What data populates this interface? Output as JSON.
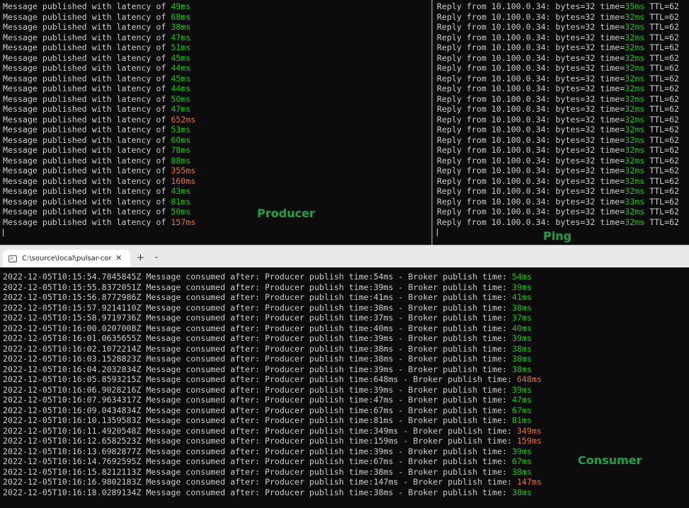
{
  "producer": {
    "prefix": "Message published with latency of ",
    "lines": [
      {
        "latency": "49ms",
        "status": "ok"
      },
      {
        "latency": "68ms",
        "status": "ok"
      },
      {
        "latency": "38ms",
        "status": "ok"
      },
      {
        "latency": "47ms",
        "status": "ok"
      },
      {
        "latency": "51ms",
        "status": "ok"
      },
      {
        "latency": "45ms",
        "status": "ok"
      },
      {
        "latency": "44ms",
        "status": "ok"
      },
      {
        "latency": "45ms",
        "status": "ok"
      },
      {
        "latency": "44ms",
        "status": "ok"
      },
      {
        "latency": "50ms",
        "status": "ok"
      },
      {
        "latency": "47ms",
        "status": "ok"
      },
      {
        "latency": "652ms",
        "status": "warn"
      },
      {
        "latency": "53ms",
        "status": "ok"
      },
      {
        "latency": "60ms",
        "status": "ok"
      },
      {
        "latency": "78ms",
        "status": "ok"
      },
      {
        "latency": "88ms",
        "status": "ok"
      },
      {
        "latency": "355ms",
        "status": "warn"
      },
      {
        "latency": "160ms",
        "status": "warn"
      },
      {
        "latency": "43ms",
        "status": "ok"
      },
      {
        "latency": "81ms",
        "status": "ok"
      },
      {
        "latency": "50ms",
        "status": "ok"
      },
      {
        "latency": "157ms",
        "status": "warn"
      }
    ],
    "label": "Producer"
  },
  "ping": {
    "prefix": "Reply from 10.100.0.34: bytes=32 time=",
    "suffix": " TTL=62",
    "lines": [
      {
        "time": "35ms"
      },
      {
        "time": "32ms"
      },
      {
        "time": "32ms"
      },
      {
        "time": "32ms"
      },
      {
        "time": "32ms"
      },
      {
        "time": "32ms"
      },
      {
        "time": "32ms"
      },
      {
        "time": "32ms"
      },
      {
        "time": "32ms"
      },
      {
        "time": "32ms"
      },
      {
        "time": "32ms"
      },
      {
        "time": "32ms"
      },
      {
        "time": "32ms"
      },
      {
        "time": "32ms"
      },
      {
        "time": "32ms"
      },
      {
        "time": "32ms"
      },
      {
        "time": "32ms"
      },
      {
        "time": "32ms"
      },
      {
        "time": "32ms"
      },
      {
        "time": "33ms"
      },
      {
        "time": "32ms"
      },
      {
        "time": "32ms"
      }
    ],
    "label": "Ping"
  },
  "tabs": {
    "active_title": "C:\\source\\local\\pulsar-consur",
    "close_glyph": "✕",
    "new_tab_glyph": "+",
    "dropdown_glyph": "⌄",
    "icon_glyph": ">_"
  },
  "consumer": {
    "middle": " Message consumed after: Producer publish time:",
    "broker": " - Broker publish time: ",
    "lines": [
      {
        "ts": "2022-12-05T10:15:54.7845845Z",
        "prod": "54ms",
        "broker": "54ms",
        "status": "ok"
      },
      {
        "ts": "2022-12-05T10:15:55.8372051Z",
        "prod": "39ms",
        "broker": "39ms",
        "status": "ok"
      },
      {
        "ts": "2022-12-05T10:15:56.8772986Z",
        "prod": "41ms",
        "broker": "41ms",
        "status": "ok"
      },
      {
        "ts": "2022-12-05T10:15:57.9214110Z",
        "prod": "38ms",
        "broker": "38ms",
        "status": "ok"
      },
      {
        "ts": "2022-12-05T10:15:58.9719736Z",
        "prod": "37ms",
        "broker": "37ms",
        "status": "ok"
      },
      {
        "ts": "2022-12-05T10:16:00.0207008Z",
        "prod": "40ms",
        "broker": "40ms",
        "status": "ok"
      },
      {
        "ts": "2022-12-05T10:16:01.0635655Z",
        "prod": "39ms",
        "broker": "39ms",
        "status": "ok"
      },
      {
        "ts": "2022-12-05T10:16:02.1072214Z",
        "prod": "38ms",
        "broker": "38ms",
        "status": "ok"
      },
      {
        "ts": "2022-12-05T10:16:03.1528823Z",
        "prod": "38ms",
        "broker": "38ms",
        "status": "ok"
      },
      {
        "ts": "2022-12-05T10:16:04.2032834Z",
        "prod": "39ms",
        "broker": "38ms",
        "status": "ok"
      },
      {
        "ts": "2022-12-05T10:16:05.8593215Z",
        "prod": "648ms",
        "broker": "648ms",
        "status": "warn"
      },
      {
        "ts": "2022-12-05T10:16:06.9028216Z",
        "prod": "39ms",
        "broker": "39ms",
        "status": "ok"
      },
      {
        "ts": "2022-12-05T10:16:07.9634317Z",
        "prod": "47ms",
        "broker": "47ms",
        "status": "ok"
      },
      {
        "ts": "2022-12-05T10:16:09.0434834Z",
        "prod": "67ms",
        "broker": "67ms",
        "status": "ok"
      },
      {
        "ts": "2022-12-05T10:16:10.1359583Z",
        "prod": "81ms",
        "broker": "81ms",
        "status": "ok"
      },
      {
        "ts": "2022-12-05T10:16:11.4920548Z",
        "prod": "349ms",
        "broker": "349ms",
        "status": "warn"
      },
      {
        "ts": "2022-12-05T10:16:12.6582523Z",
        "prod": "159ms",
        "broker": "159ms",
        "status": "warn"
      },
      {
        "ts": "2022-12-05T10:16:13.6982877Z",
        "prod": "39ms",
        "broker": "39ms",
        "status": "ok"
      },
      {
        "ts": "2022-12-05T10:16:14.7692595Z",
        "prod": "67ms",
        "broker": "67ms",
        "status": "ok"
      },
      {
        "ts": "2022-12-05T10:16:15.8212113Z",
        "prod": "38ms",
        "broker": "38ms",
        "status": "ok"
      },
      {
        "ts": "2022-12-05T10:16:16.9802183Z",
        "prod": "147ms",
        "broker": "147ms",
        "status": "warn"
      },
      {
        "ts": "2022-12-05T10:16:18.0289134Z",
        "prod": "38ms",
        "broker": "38ms",
        "status": "ok"
      }
    ],
    "label": "Consumer"
  },
  "colors": {
    "ok": "#16c60c",
    "warn": "#e8702a",
    "label": "#1fa24a",
    "terminal_bg": "#0c0c0c",
    "terminal_fg": "#cccccc"
  }
}
